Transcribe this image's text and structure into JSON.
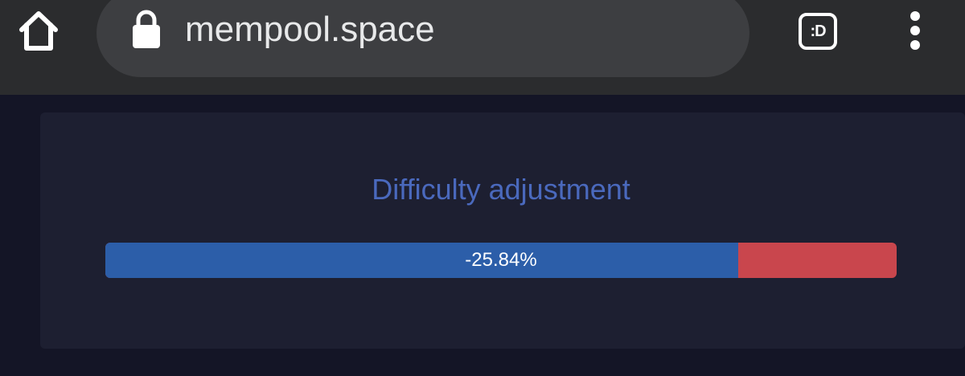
{
  "browser": {
    "url": "mempool.space",
    "home_icon": "home-icon",
    "lock_icon": "lock-icon",
    "tab_icon_text": ":D",
    "menu_icon": "more-vert-icon"
  },
  "difficulty": {
    "title": "Difficulty adjustment",
    "change_label": "-25.84%",
    "progress_fraction": 0.8,
    "colors": {
      "title": "#4a69bd",
      "progress": "#2c5ea9",
      "remaining": "#c9464d"
    }
  }
}
